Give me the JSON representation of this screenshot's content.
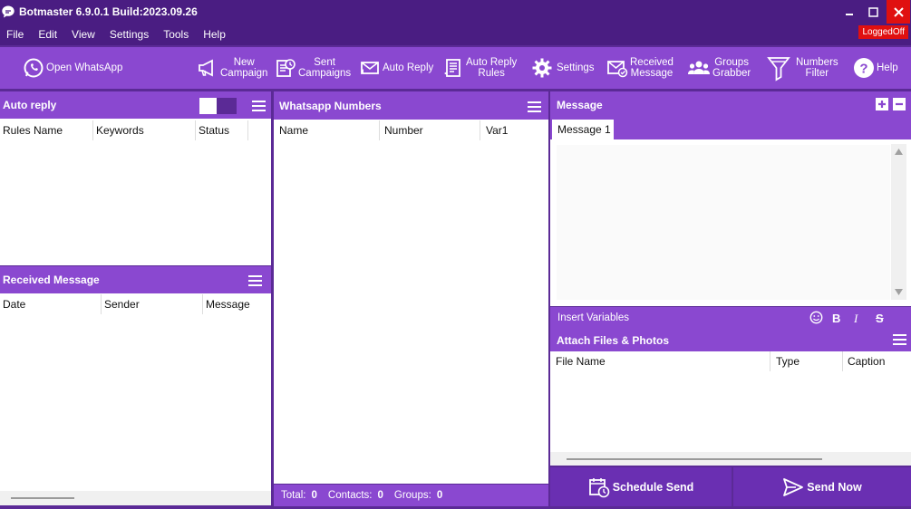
{
  "window": {
    "title": "Botmaster 6.9.0.1 Build:2023.09.26"
  },
  "menu": [
    "File",
    "Edit",
    "View",
    "Settings",
    "Tools",
    "Help"
  ],
  "status_badge": "LoggedOff",
  "toolbar": {
    "open_whatsapp": "Open WhatsApp",
    "new_campaign": [
      "New",
      "Campaign"
    ],
    "sent_campaigns": [
      "Sent",
      "Campaigns"
    ],
    "auto_reply": "Auto Reply",
    "auto_reply_rules": [
      "Auto Reply",
      "Rules"
    ],
    "settings": "Settings",
    "received_message": [
      "Received",
      "Message"
    ],
    "groups_grabber": [
      "Groups",
      "Grabber"
    ],
    "numbers_filter": [
      "Numbers",
      "Filter"
    ],
    "help": "Help"
  },
  "auto_reply_panel": {
    "title": "Auto reply",
    "columns": [
      "Rules Name",
      "Keywords",
      "Status"
    ]
  },
  "received_panel": {
    "title": "Received Message",
    "columns": [
      "Date",
      "Sender",
      "Message"
    ]
  },
  "numbers_panel": {
    "title": "Whatsapp Numbers",
    "columns": [
      "Name",
      "Number",
      "Var1"
    ]
  },
  "status": {
    "total_label": "Total:",
    "total": "0",
    "contacts_label": "Contacts:",
    "contacts": "0",
    "groups_label": "Groups:",
    "groups": "0"
  },
  "message_panel": {
    "title": "Message",
    "tab": "Message 1",
    "insert_variables": "Insert Variables",
    "format": {
      "bold": "B",
      "italic": "I",
      "strike": "S"
    }
  },
  "attach_panel": {
    "title": "Attach Files & Photos",
    "columns": [
      "File Name",
      "Type",
      "Caption"
    ]
  },
  "actions": {
    "schedule": "Schedule Send",
    "send_now": "Send Now"
  },
  "colors": {
    "toolbar": "#8a48d0",
    "title": "#4a1d82",
    "logged": "#e01010"
  }
}
